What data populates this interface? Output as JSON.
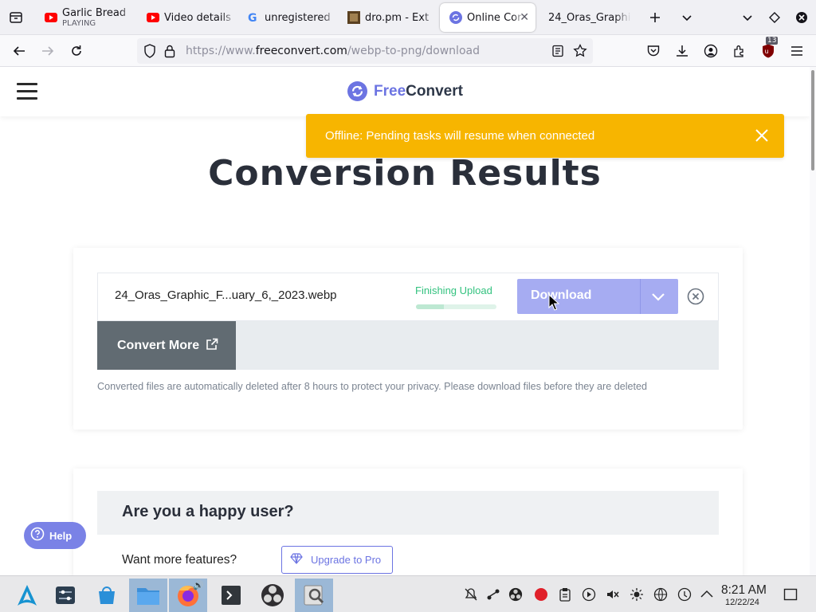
{
  "browser": {
    "tabs": [
      {
        "title": "Garlic Bread",
        "subtitle": "PLAYING",
        "favicon": "youtube-icon",
        "active": false
      },
      {
        "title": "Video details",
        "favicon": "youtube-icon",
        "active": false
      },
      {
        "title": "unregistered",
        "favicon": "google-icon",
        "active": false
      },
      {
        "title": "dro.pm - Ext",
        "favicon": "dropm-icon",
        "active": false
      },
      {
        "title": "Online Cor",
        "favicon": "freeconvert-icon",
        "active": true
      },
      {
        "title": "24_Oras_Graphi",
        "favicon": "",
        "active": false
      }
    ],
    "url_prefix": "https://www.",
    "url_host": "freeconvert.com",
    "url_path": "/webp-to-png/download",
    "badge_count": "13"
  },
  "site": {
    "logo_free": "Free",
    "logo_convert": "Convert"
  },
  "toast": {
    "message": "Offline: Pending tasks will resume when connected",
    "color": "#f7b500"
  },
  "page": {
    "title": "Conversion Results"
  },
  "result": {
    "file_name": "24_Oras_Graphic_F...uary_6,_2023.webp",
    "status": "Finishing Upload",
    "progress": 0.35,
    "download_label": "Download",
    "convert_more_label": "Convert More",
    "note": "Converted files are automatically deleted after 8 hours to protect your privacy. Please download files before they are deleted"
  },
  "happy": {
    "title": "Are you a happy user?",
    "features": "Want more features?",
    "upgrade_label": "Upgrade to Pro"
  },
  "help": {
    "label": "Help"
  },
  "taskbar": {
    "time": "8:21 AM",
    "date": "12/22/24"
  },
  "colors": {
    "accent": "#6c74e2",
    "download_button": "#a6acf2",
    "status_green": "#33c27f"
  }
}
